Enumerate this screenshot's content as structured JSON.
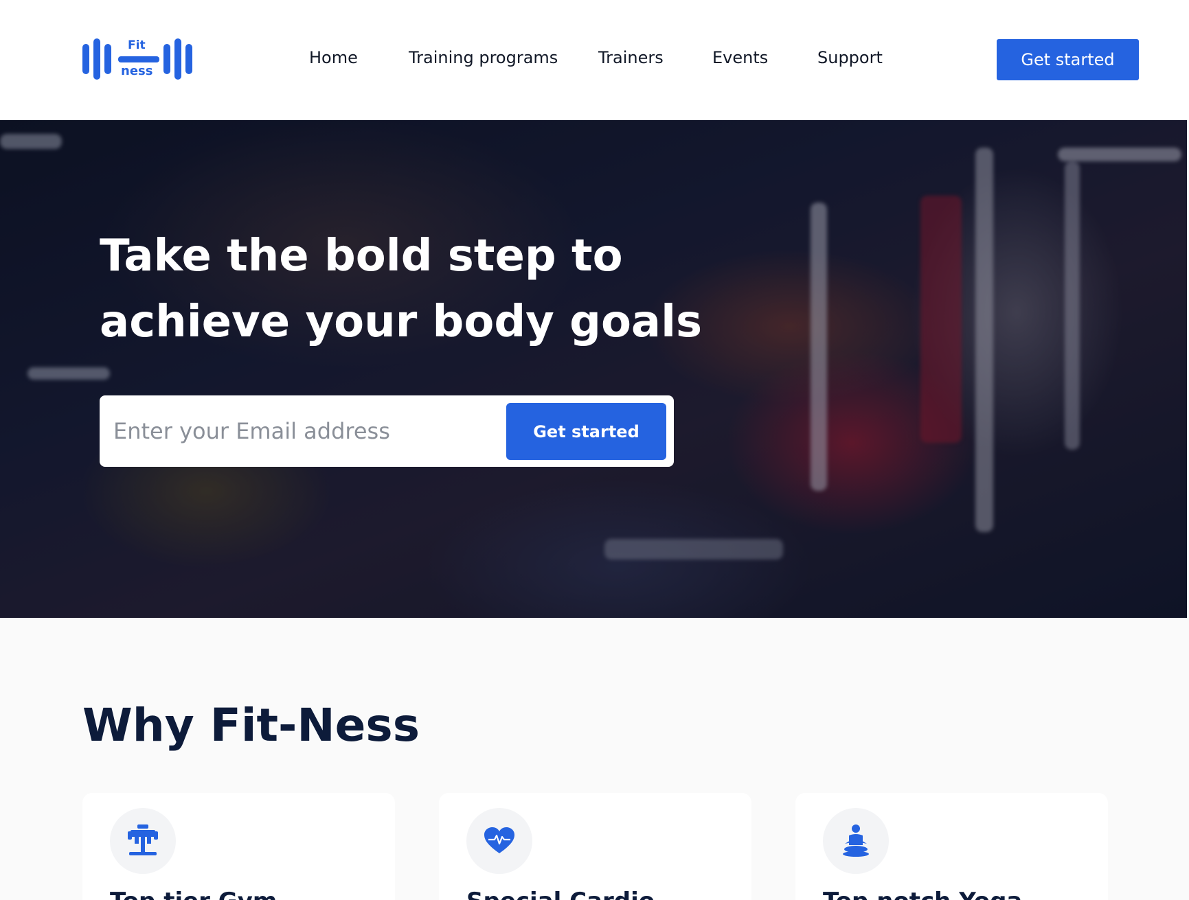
{
  "brand": {
    "logo_top": "Fit",
    "logo_bottom": "ness"
  },
  "nav": {
    "items": [
      {
        "label": "Home"
      },
      {
        "label": "Training programs"
      },
      {
        "label": "Trainers"
      },
      {
        "label": "Events"
      },
      {
        "label": "Support"
      }
    ],
    "cta_label": "Get started"
  },
  "hero": {
    "title": "Take the bold step to achieve your body goals",
    "email_placeholder": "Enter your Email address",
    "cta_label": "Get started"
  },
  "why": {
    "title": "Why Fit-Ness",
    "cards": [
      {
        "title": "Top tier Gym",
        "icon": "gym-machine-icon"
      },
      {
        "title": "Special Cardio",
        "icon": "heart-pulse-icon"
      },
      {
        "title": "Top notch Yoga",
        "icon": "yoga-person-icon"
      }
    ]
  },
  "colors": {
    "accent": "#2563e0",
    "heading": "#0d1b3a",
    "page_bg": "#fafafa"
  }
}
